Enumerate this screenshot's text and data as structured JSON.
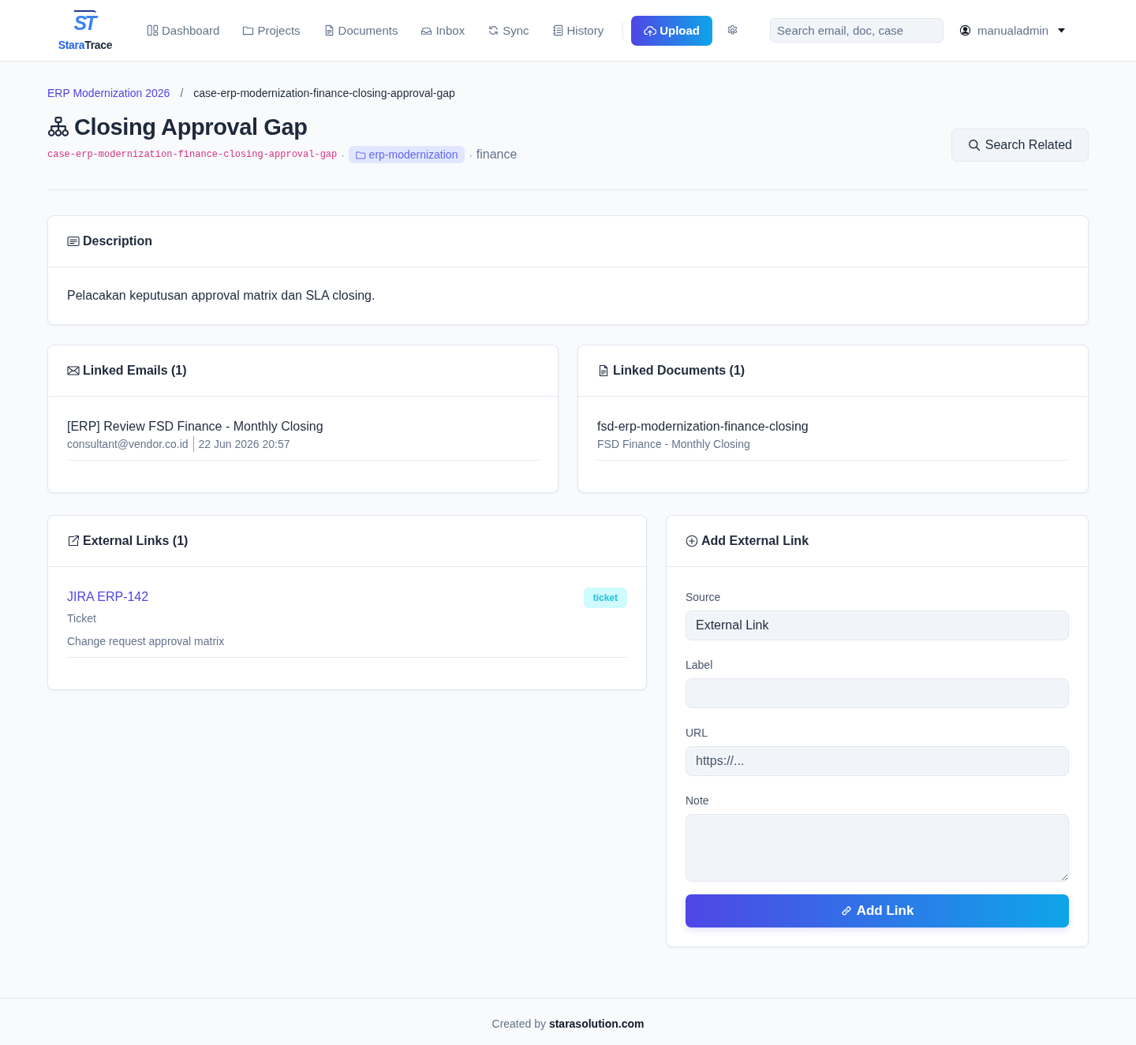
{
  "navbar": {
    "brand": {
      "logo_text": "ST",
      "name_first": "Stara",
      "name_second": "Trace"
    },
    "items": [
      {
        "label": "Dashboard",
        "selected": false
      },
      {
        "label": "Projects",
        "selected": false
      },
      {
        "label": "Documents",
        "selected": false
      },
      {
        "label": "Inbox",
        "selected": false
      },
      {
        "label": "Sync",
        "selected": false
      },
      {
        "label": "History",
        "selected": false
      }
    ],
    "upload_button": "Upload",
    "search": {
      "placeholder": "Search email, doc, case"
    },
    "user": {
      "name": "manualadmin"
    }
  },
  "breadcrumb": {
    "parent": "ERP Modernization 2026",
    "separator": "/",
    "current": "case-erp-modernization-finance-closing-approval-gap"
  },
  "header": {
    "title": "Closing Approval Gap",
    "slug": "case-erp-modernization-finance-closing-approval-gap",
    "separator_1": "·",
    "project": "erp-modernization",
    "separator_2": "·",
    "category": "finance",
    "search_related_button": "Search Related"
  },
  "description": {
    "title": "Description",
    "text": "Pelacakan keputusan approval matrix dan SLA closing."
  },
  "linked_emails": {
    "title": "Linked Emails (1)",
    "items": [
      {
        "subject": "[ERP] Review FSD Finance - Monthly Closing",
        "sender": "consultant@vendor.co.id",
        "date": "22 Jun 2026 20:57"
      }
    ]
  },
  "linked_documents": {
    "title": "Linked Documents (1)",
    "items": [
      {
        "name": "fsd-erp-modernization-finance-closing",
        "subtitle": "FSD Finance - Monthly Closing"
      }
    ]
  },
  "external_links": {
    "title": "External Links (1)",
    "items": [
      {
        "label": "JIRA ERP-142",
        "tag": "ticket",
        "type": "Ticket",
        "note": "Change request approval matrix"
      }
    ]
  },
  "add_external_link": {
    "title": "Add External Link",
    "fields": [
      {
        "kind": "input",
        "label": "Source",
        "value": "External Link"
      },
      {
        "kind": "input",
        "label": "Label"
      },
      {
        "kind": "input",
        "label": "URL",
        "placeholder": "https://..."
      },
      {
        "kind": "textarea",
        "label": "Note"
      }
    ],
    "button": "Add Link"
  },
  "footer": {
    "text": "Created by **starasolution.com**"
  }
}
